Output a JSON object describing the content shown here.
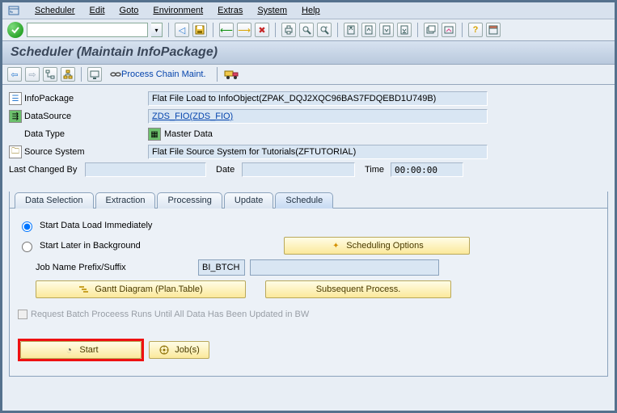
{
  "menu": {
    "items": [
      "Scheduler",
      "Edit",
      "Goto",
      "Environment",
      "Extras",
      "System",
      "Help"
    ]
  },
  "page_title": "Scheduler (Maintain InfoPackage)",
  "app_toolbar": {
    "process_chain": "Process Chain Maint."
  },
  "form": {
    "labels": {
      "infopackage": "InfoPackage",
      "datasource": "DataSource",
      "datatype": "Data Type",
      "source_system": "Source System",
      "last_changed_by": "Last Changed By",
      "date": "Date",
      "time": "Time"
    },
    "values": {
      "infopackage": "Flat File Load to InfoObject(ZPAK_DQJ2XQC96BAS7FDQEBD1U749B)",
      "datasource": "ZDS_FIO(ZDS_FIO)",
      "datatype": "Master Data",
      "source_system": "Flat File Source System for Tutorials(ZFTUTORIAL)",
      "last_changed_by": "",
      "date": "",
      "time": "00:00:00"
    }
  },
  "tabs": [
    "Data Selection",
    "Extraction",
    "Processing",
    "Update",
    "Schedule"
  ],
  "active_tab": "Schedule",
  "schedule": {
    "radio_immediate": "Start Data Load Immediately",
    "radio_later": "Start Later in Background",
    "scheduling_options": "Scheduling Options",
    "job_prefix_label": "Job Name Prefix/Suffix",
    "job_prefix_val": "BI_BTCH",
    "job_suffix_val": "",
    "gantt": "Gantt Diagram (Plan.Table)",
    "subsequent": "Subsequent Process.",
    "batch_checkbox": "Request Batch Proceess Runs Until All Data Has Been Updated in BW",
    "start": "Start",
    "jobs": "Job(s)"
  }
}
